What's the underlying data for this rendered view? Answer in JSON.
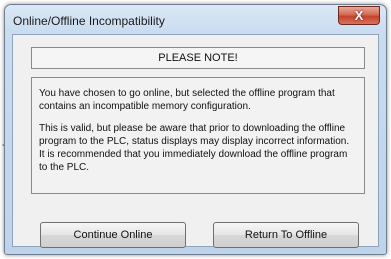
{
  "background": {
    "mark": "-"
  },
  "window": {
    "title": "Online/Offline Incompatibility",
    "close_glyph": "X"
  },
  "notice": {
    "heading": "PLEASE NOTE!"
  },
  "message": {
    "paragraph1": "You have chosen to go online, but selected the offline program that contains an incompatible memory configuration.",
    "paragraph2": "This is valid, but please be aware that prior to downloading the offline program to the PLC, status displays may display incorrect information. It is recommended that you immediately download the offline program to the PLC."
  },
  "buttons": {
    "continue_label": "Continue Online",
    "return_label": "Return To Offline"
  },
  "colors": {
    "close_button": "#c3422a",
    "window_frame": "#bfd3ea",
    "client_background": "#f0f0f0"
  }
}
